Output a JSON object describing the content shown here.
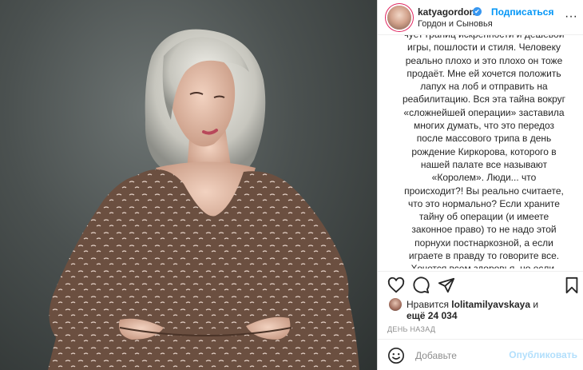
{
  "post": {
    "username": "katyagordon",
    "verified_mark": "✔",
    "follow_label": "Подписаться",
    "location": "Гордон и Сыновья",
    "more_label": "···",
    "caption": "чует границ искренности и дешевой\nигры, пошлости и стиля. Человеку\nреально плохо и это плохо он тоже\nпродаёт. Мне ей хочется положить\nлапух на лоб и отправить на\nреабилитацию. Вся эта тайна вокруг\n«сложнейшей операции» заставила\nмногих думать, что это передоз\nпосле массового трипа в день\nрождение Киркорова, которого в\nнашей палате все называют\n«Королем». Люди... что\nпроисходит?! Вы реально считаете,\nчто это нормально? Если храните\nтайну об операции (и имеете\nзаконное право) то не надо этой\nпорнухи постнаркозной, а если\nиграете в правду то говорите все.\nХочется всем здоровья, но если,\nмадам, у вас геморрой или передоз -",
    "likes_prefix": "Нравится",
    "liker": "lolitamilyavskaya",
    "likes_and": "и",
    "likes_more": "ещё 24 034",
    "time": "ДЕНЬ НАЗАД",
    "comment_placeholder": "Добавьте",
    "publish_label": "Опубликовать"
  },
  "icons": {
    "like": "heart-icon",
    "comment": "comment-icon",
    "share": "share-icon",
    "save": "bookmark-icon",
    "emoji": "emoji-icon"
  },
  "colors": {
    "accent": "#0095f6",
    "verified": "#3897f0",
    "publish_disabled": "#b2dffc",
    "muted": "#8e8e8e"
  }
}
